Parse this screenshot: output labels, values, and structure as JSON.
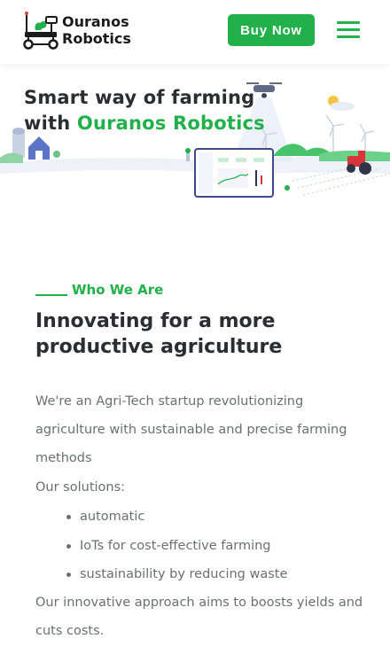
{
  "header": {
    "logo_line1": "Ouranos",
    "logo_line2": "Robotics",
    "buy_label": "Buy Now",
    "accent_color": "#22b04b",
    "menu_icon": "hamburger-icon"
  },
  "hero": {
    "title_line1": "Smart way of farming",
    "title_prefix": "with ",
    "title_brand": "Ouranos Robotics",
    "illustration": "smart-farm-illustration"
  },
  "about": {
    "eyebrow": "Who We Are",
    "headline": "Innovating for a more productive agriculture",
    "intro": "We're an Agri-Tech startup revolutionizing agriculture with sustainable and precise farming methods",
    "solutions_label": "Our solutions:",
    "solutions": [
      "automatic",
      "IoTs for cost-effective farming",
      "sustainability by reducing waste"
    ],
    "closing": "Our innovative approach aims to boosts yields and cuts costs."
  }
}
